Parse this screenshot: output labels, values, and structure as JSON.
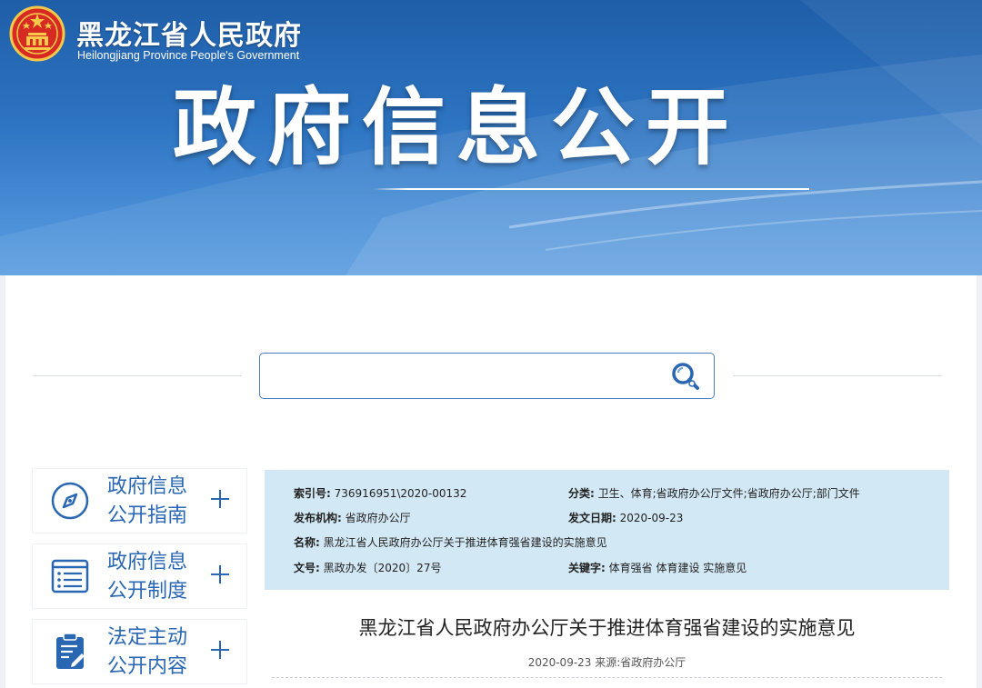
{
  "site": {
    "name_cn": "黑龙江省人民政府",
    "name_en": "Heilongjiang Province People's Government"
  },
  "banner": {
    "title": "政府信息公开"
  },
  "search": {
    "placeholder": "",
    "value": ""
  },
  "sidebar": {
    "items": [
      {
        "line1": "政府信息",
        "line2": "公开指南",
        "icon": "compass-icon"
      },
      {
        "line1": "政府信息",
        "line2": "公开制度",
        "icon": "list-icon"
      },
      {
        "line1": "法定主动",
        "line2": "公开内容",
        "icon": "clipboard-icon"
      }
    ]
  },
  "meta": {
    "index_label": "索引号:",
    "index_value": "736916951\\2020-00132",
    "category_label": "分类:",
    "category_value": "卫生、体育;省政府办公厅文件;省政府办公厅;部门文件",
    "publisher_label": "发布机构:",
    "publisher_value": "省政府办公厅",
    "date_label": "发文日期:",
    "date_value": "2020-09-23",
    "name_label": "名称:",
    "name_value": "黑龙江省人民政府办公厅关于推进体育强省建设的实施意见",
    "docno_label": "文号:",
    "docno_value": "黑政办发〔2020〕27号",
    "keywords_label": "关键字:",
    "keywords_value": "体育强省 体育建设 实施意见"
  },
  "article": {
    "title": "黑龙江省人民政府办公厅关于推进体育强省建设的实施意见",
    "info": "2020-09-23 来源:省政府办公厅"
  },
  "colors": {
    "brand_blue": "#2a67b3",
    "meta_bg": "#d2e8f5",
    "banner_top": "#1f5ea8"
  }
}
